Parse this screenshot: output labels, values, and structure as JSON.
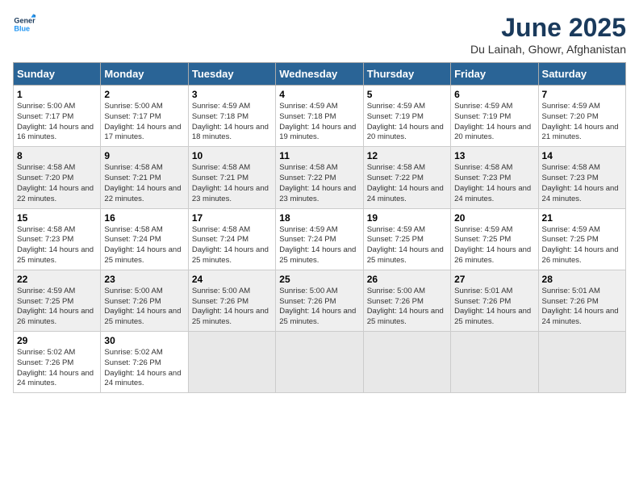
{
  "logo": {
    "line1": "General",
    "line2": "Blue"
  },
  "title": "June 2025",
  "subtitle": "Du Lainah, Ghowr, Afghanistan",
  "days_of_week": [
    "Sunday",
    "Monday",
    "Tuesday",
    "Wednesday",
    "Thursday",
    "Friday",
    "Saturday"
  ],
  "weeks": [
    [
      {
        "day": "1",
        "sunrise": "5:00 AM",
        "sunset": "7:17 PM",
        "daylight": "14 hours and 16 minutes."
      },
      {
        "day": "2",
        "sunrise": "5:00 AM",
        "sunset": "7:17 PM",
        "daylight": "14 hours and 17 minutes."
      },
      {
        "day": "3",
        "sunrise": "4:59 AM",
        "sunset": "7:18 PM",
        "daylight": "14 hours and 18 minutes."
      },
      {
        "day": "4",
        "sunrise": "4:59 AM",
        "sunset": "7:18 PM",
        "daylight": "14 hours and 19 minutes."
      },
      {
        "day": "5",
        "sunrise": "4:59 AM",
        "sunset": "7:19 PM",
        "daylight": "14 hours and 20 minutes."
      },
      {
        "day": "6",
        "sunrise": "4:59 AM",
        "sunset": "7:19 PM",
        "daylight": "14 hours and 20 minutes."
      },
      {
        "day": "7",
        "sunrise": "4:59 AM",
        "sunset": "7:20 PM",
        "daylight": "14 hours and 21 minutes."
      }
    ],
    [
      {
        "day": "8",
        "sunrise": "4:58 AM",
        "sunset": "7:20 PM",
        "daylight": "14 hours and 22 minutes."
      },
      {
        "day": "9",
        "sunrise": "4:58 AM",
        "sunset": "7:21 PM",
        "daylight": "14 hours and 22 minutes."
      },
      {
        "day": "10",
        "sunrise": "4:58 AM",
        "sunset": "7:21 PM",
        "daylight": "14 hours and 23 minutes."
      },
      {
        "day": "11",
        "sunrise": "4:58 AM",
        "sunset": "7:22 PM",
        "daylight": "14 hours and 23 minutes."
      },
      {
        "day": "12",
        "sunrise": "4:58 AM",
        "sunset": "7:22 PM",
        "daylight": "14 hours and 24 minutes."
      },
      {
        "day": "13",
        "sunrise": "4:58 AM",
        "sunset": "7:23 PM",
        "daylight": "14 hours and 24 minutes."
      },
      {
        "day": "14",
        "sunrise": "4:58 AM",
        "sunset": "7:23 PM",
        "daylight": "14 hours and 24 minutes."
      }
    ],
    [
      {
        "day": "15",
        "sunrise": "4:58 AM",
        "sunset": "7:23 PM",
        "daylight": "14 hours and 25 minutes."
      },
      {
        "day": "16",
        "sunrise": "4:58 AM",
        "sunset": "7:24 PM",
        "daylight": "14 hours and 25 minutes."
      },
      {
        "day": "17",
        "sunrise": "4:58 AM",
        "sunset": "7:24 PM",
        "daylight": "14 hours and 25 minutes."
      },
      {
        "day": "18",
        "sunrise": "4:59 AM",
        "sunset": "7:24 PM",
        "daylight": "14 hours and 25 minutes."
      },
      {
        "day": "19",
        "sunrise": "4:59 AM",
        "sunset": "7:25 PM",
        "daylight": "14 hours and 25 minutes."
      },
      {
        "day": "20",
        "sunrise": "4:59 AM",
        "sunset": "7:25 PM",
        "daylight": "14 hours and 26 minutes."
      },
      {
        "day": "21",
        "sunrise": "4:59 AM",
        "sunset": "7:25 PM",
        "daylight": "14 hours and 26 minutes."
      }
    ],
    [
      {
        "day": "22",
        "sunrise": "4:59 AM",
        "sunset": "7:25 PM",
        "daylight": "14 hours and 26 minutes."
      },
      {
        "day": "23",
        "sunrise": "5:00 AM",
        "sunset": "7:26 PM",
        "daylight": "14 hours and 25 minutes."
      },
      {
        "day": "24",
        "sunrise": "5:00 AM",
        "sunset": "7:26 PM",
        "daylight": "14 hours and 25 minutes."
      },
      {
        "day": "25",
        "sunrise": "5:00 AM",
        "sunset": "7:26 PM",
        "daylight": "14 hours and 25 minutes."
      },
      {
        "day": "26",
        "sunrise": "5:00 AM",
        "sunset": "7:26 PM",
        "daylight": "14 hours and 25 minutes."
      },
      {
        "day": "27",
        "sunrise": "5:01 AM",
        "sunset": "7:26 PM",
        "daylight": "14 hours and 25 minutes."
      },
      {
        "day": "28",
        "sunrise": "5:01 AM",
        "sunset": "7:26 PM",
        "daylight": "14 hours and 24 minutes."
      }
    ],
    [
      {
        "day": "29",
        "sunrise": "5:02 AM",
        "sunset": "7:26 PM",
        "daylight": "14 hours and 24 minutes."
      },
      {
        "day": "30",
        "sunrise": "5:02 AM",
        "sunset": "7:26 PM",
        "daylight": "14 hours and 24 minutes."
      },
      null,
      null,
      null,
      null,
      null
    ]
  ],
  "labels": {
    "sunrise": "Sunrise:",
    "sunset": "Sunset:",
    "daylight": "Daylight:"
  }
}
